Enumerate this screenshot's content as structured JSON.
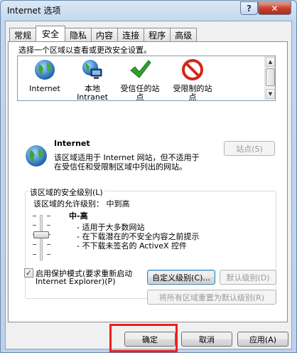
{
  "window": {
    "title": "Internet 选项",
    "help_glyph": "?",
    "close_glyph": "✕"
  },
  "tabs": [
    {
      "label": "常规",
      "active": false
    },
    {
      "label": "安全",
      "active": true
    },
    {
      "label": "隐私",
      "active": false
    },
    {
      "label": "内容",
      "active": false
    },
    {
      "label": "连接",
      "active": false
    },
    {
      "label": "程序",
      "active": false
    },
    {
      "label": "高级",
      "active": false
    }
  ],
  "security": {
    "instruction": "选择一个区域以查看或更改安全设置。",
    "zones": [
      {
        "label_line1": "Internet",
        "label_line2": "",
        "icon": "globe-icon",
        "selected": true
      },
      {
        "label_line1": "本地",
        "label_line2": "Intranet",
        "icon": "intranet-icon",
        "selected": false
      },
      {
        "label_line1": "受信任的站",
        "label_line2": "点",
        "icon": "check-icon",
        "selected": false
      },
      {
        "label_line1": "受限制的站",
        "label_line2": "点",
        "icon": "restricted-icon",
        "selected": false
      }
    ],
    "zone_title": "Internet",
    "zone_desc_line1": "该区域适用于 Internet 网站，但不适用于",
    "zone_desc_line2": "在受信任和受限制区域中列出的网站。",
    "sites_button": "站点(S)",
    "group_title": "该区域的安全级别(L)",
    "allowed_levels": "该区域的允许级别： 中到高",
    "level_name": "中-高",
    "level_points": [
      "- 适用于大多数网站",
      "- 在下载潜在的不安全内容之前提示",
      "- 不下载未签名的 ActiveX 控件"
    ],
    "protected_mode_line1": "启用保护模式(要求重新启动",
    "protected_mode_line2": "Internet Explorer)(P)",
    "protected_mode_checked": true,
    "checkbox_mark": "✓",
    "custom_level_button": "自定义级别(C)...",
    "default_level_button": "默认级别(D)",
    "reset_all_button": "将所有区域重置为默认级别(R)"
  },
  "footer": {
    "ok": "确定",
    "cancel": "取消",
    "apply": "应用(A)"
  },
  "colors": {
    "highlight_frame": "#e8201f",
    "accent_blue": "#3c7fb1"
  }
}
